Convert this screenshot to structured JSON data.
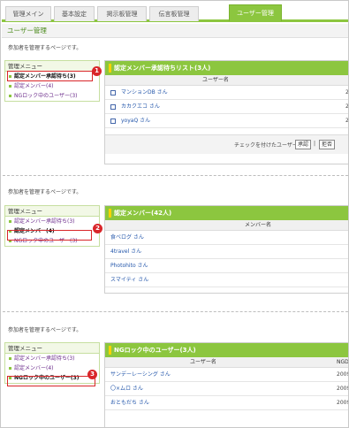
{
  "tabs": [
    {
      "label": "管理メイン"
    },
    {
      "label": "基本設定"
    },
    {
      "label": "掲示板管理"
    },
    {
      "label": "伝言板管理"
    },
    {
      "label": "ユーザー管理"
    }
  ],
  "page_title": "ユーザー管理",
  "sections": [
    {
      "description": "参加者を管理するページです。",
      "menu": {
        "title": "管理メニュー",
        "items": [
          {
            "label": "認定メンバー承認待ち(3)"
          },
          {
            "label": "認定メンバー(4)"
          },
          {
            "label": "NGロック中のユーザー(3)"
          }
        ]
      },
      "badge": "1",
      "panel": {
        "title": "認定メンバー承認待ちリスト(3人)",
        "column": "ユーザー名",
        "rows": [
          {
            "name": "マンションDB さん",
            "trailing": "2"
          },
          {
            "name": "カカクエコ さん",
            "trailing": "2"
          },
          {
            "name": "yoyaQ さん",
            "trailing": "2"
          }
        ],
        "action_text": "チェックを付けたユーザーを",
        "approve_label": "承認",
        "divider": "|",
        "reject_label": "拒否"
      }
    },
    {
      "description": "参加者を管理するページです。",
      "menu": {
        "title": "管理メニュー",
        "items": [
          {
            "label": "認定メンバー承認待ち(3)"
          },
          {
            "label": "認定メンバー(4)"
          },
          {
            "label": "NGロック中のユーザー(3)"
          }
        ]
      },
      "badge": "2",
      "panel": {
        "title": "認定メンバー(42人)",
        "column": "メンバー名",
        "rows": [
          {
            "name": "食べログ さん"
          },
          {
            "name": "4travel さん"
          },
          {
            "name": "Photohito さん"
          },
          {
            "name": "スマイティ さん"
          }
        ]
      }
    },
    {
      "description": "参加者を管理するページです。",
      "menu": {
        "title": "管理メニュー",
        "items": [
          {
            "label": "認定メンバー承認待ち(3)"
          },
          {
            "label": "認定メンバー(4)"
          },
          {
            "label": "NGロック中のユーザー(3)"
          }
        ]
      },
      "badge": "3",
      "panel": {
        "title": "NGロック中のユーザー(3人)",
        "column": "ユーザー名",
        "column2": "NGD",
        "rows": [
          {
            "name": "サンデーレーシング さん",
            "trailing": "2009"
          },
          {
            "name": "〇×ムロ さん",
            "trailing": "2009"
          },
          {
            "name": "おともだち さん",
            "trailing": "2009"
          }
        ]
      }
    }
  ],
  "colors": {
    "accent": "#8cc63f",
    "highlight": "#d9262a",
    "title_bar_marker": "#ffd200"
  }
}
